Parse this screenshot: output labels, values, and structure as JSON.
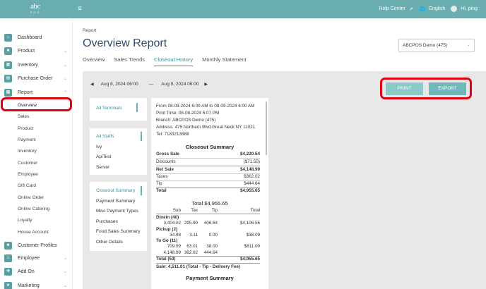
{
  "topbar": {
    "logo_text": "abc",
    "logo_sub": "POS",
    "menu_icon": "hamburger-icon",
    "help_center": "Help Center",
    "language": "English",
    "greeting": "Hi, ping"
  },
  "sidebar": {
    "dashboard": "Dashboard",
    "product": "Product",
    "inventory": "Inventory",
    "purchase_order": "Purchase Order",
    "report": "Report",
    "report_sub": [
      "Overview",
      "Sales",
      "Product",
      "Payment",
      "Inventory",
      "Customer",
      "Employee",
      "Gift Card",
      "Online Order",
      "Online Catering",
      "Loyalty",
      "House Account"
    ],
    "customer_profiles": "Customer Profiles",
    "employee": "Employee",
    "add_on": "Add On",
    "marketing": "Marketing"
  },
  "header": {
    "breadcrumb": "Report",
    "title": "Overview Report",
    "store": "ABCPOS Demo (475)"
  },
  "tabs": [
    "Overview",
    "Sales Trends",
    "Closeout History",
    "Monthly Statement"
  ],
  "date_range": {
    "start": "Aug 8, 2024 06:00",
    "separator": "—",
    "end": "Aug 9, 2024 06:00"
  },
  "buttons": {
    "print": "PRINT",
    "export": "EXPORT"
  },
  "filters": {
    "terminals": "All Terminals",
    "staffs": [
      "All Staffs",
      "Ivy",
      "ApiTest",
      "Server"
    ],
    "report_types": [
      "Closeout Summary",
      "Payment Summary",
      "Misc Payment Types",
      "Purchases",
      "Food Sales Summary",
      "Other Details"
    ]
  },
  "report": {
    "from": "From 08-08-2024 6:00 AM to 08-09-2024 6:00 AM",
    "print_time": "Print Time: 08-08-2024 6:07 PM",
    "branch": "Branch: ABCPOS Demo (475)",
    "address": "Address: 475 Northern Blvd Great Neck NY 11021",
    "tel": "Tel: 7183213888",
    "closeout_title": "Closeout Summary",
    "summary_rows": [
      {
        "label": "Gross Sale",
        "value": "$4,220.54"
      },
      {
        "label": "Discounts",
        "value": "($71.55)"
      },
      {
        "label": "Net Sale",
        "value": "$4,148.99"
      },
      {
        "label": "Taxes",
        "value": "$362.02"
      },
      {
        "label": "Tip",
        "value": "$444.64"
      },
      {
        "label": "Total",
        "value": "$4,955.65"
      }
    ],
    "total_title": "Total $4,955.65",
    "col_headers": [
      "Sub",
      "Tax",
      "Tip",
      "Total"
    ],
    "groups": [
      {
        "name": "Dinein (40)",
        "sub": "3,404.02",
        "tax": "295.90",
        "tip": "406.64",
        "total": "$4,106.56"
      },
      {
        "name": "Pickup (2)",
        "sub": "34.98",
        "tax": "3.11",
        "tip": "0.00",
        "total": "$38.09"
      },
      {
        "name": "To Go (11)",
        "sub": "709.99",
        "tax": "63.01",
        "tip": "38.00",
        "total": "$811.00"
      }
    ],
    "grand": {
      "sub": "4,148.99",
      "tax": "362.02",
      "tip": "444.64"
    },
    "total_row": {
      "label": "Total (53)",
      "value": "$4,955.65"
    },
    "sale_note": "Sale: 4,511.01 (Total - Tip - Delivery Fee)",
    "payment_title": "Payment Summary"
  },
  "colors": {
    "accent": "#6aaeb0",
    "highlight": "#e00012",
    "title": "#2b4c6f"
  }
}
